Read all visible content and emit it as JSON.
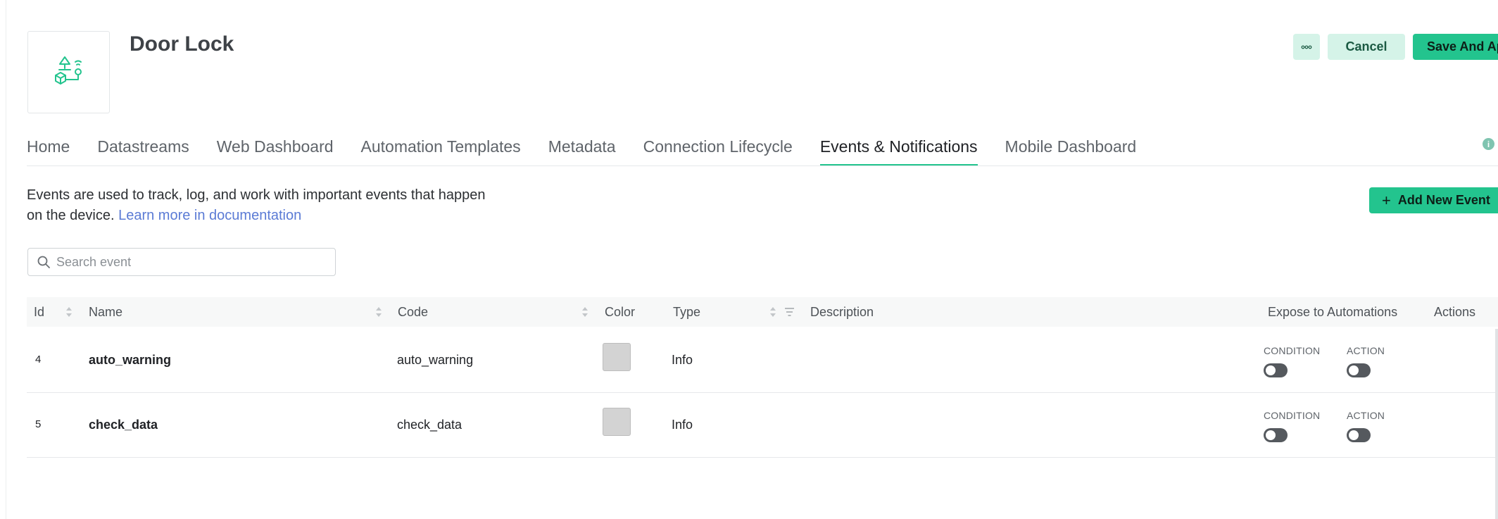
{
  "header": {
    "title": "Door Lock",
    "more_label": "•••",
    "cancel_label": "Cancel",
    "save_label": "Save And Apply"
  },
  "tabs": [
    {
      "label": "Home",
      "active": false
    },
    {
      "label": "Datastreams",
      "active": false
    },
    {
      "label": "Web Dashboard",
      "active": false
    },
    {
      "label": "Automation Templates",
      "active": false
    },
    {
      "label": "Metadata",
      "active": false
    },
    {
      "label": "Connection Lifecycle",
      "active": false
    },
    {
      "label": "Events & Notifications",
      "active": true
    },
    {
      "label": "Mobile Dashboard",
      "active": false
    }
  ],
  "intro": {
    "text_line1": "Events are used to track, log, and work with important events that happen",
    "text_line2": "on the device. ",
    "link_text": "Learn more in documentation"
  },
  "add_button_label": "Add New Event",
  "search": {
    "placeholder": "Search event",
    "value": ""
  },
  "table": {
    "columns": {
      "id": "Id",
      "name": "Name",
      "code": "Code",
      "color": "Color",
      "type": "Type",
      "description": "Description",
      "expose": "Expose to Automations",
      "actions": "Actions"
    },
    "rows": [
      {
        "id": "4",
        "name": "auto_warning",
        "code": "auto_warning",
        "color": "#d3d3d3",
        "type": "Info",
        "description": "",
        "condition_label": "CONDITION",
        "action_label": "ACTION",
        "condition_on": false,
        "action_on": false
      },
      {
        "id": "5",
        "name": "check_data",
        "code": "check_data",
        "color": "#d3d3d3",
        "type": "Info",
        "description": "",
        "condition_label": "CONDITION",
        "action_label": "ACTION",
        "condition_on": false,
        "action_on": false
      }
    ]
  },
  "colors": {
    "accent": "#23c48e",
    "accent_light": "#d5f3e8",
    "link": "#5b7bd5",
    "toggle_off": "#55595e"
  },
  "icons": {
    "device_logo": "device-automation-icon",
    "search": "search-icon",
    "info": "info-icon"
  }
}
